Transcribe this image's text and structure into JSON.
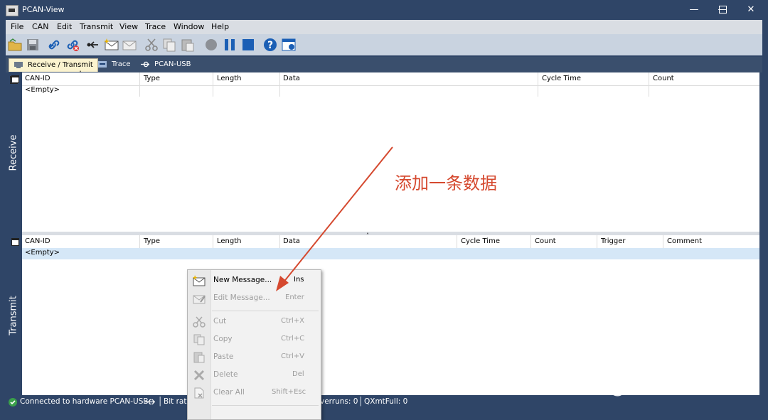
{
  "window": {
    "title": "PCAN-View"
  },
  "menu": [
    "File",
    "CAN",
    "Edit",
    "Transmit",
    "View",
    "Trace",
    "Window",
    "Help"
  ],
  "tabs": [
    "Receive / Transmit",
    "Trace",
    "PCAN-USB"
  ],
  "receive": {
    "side_label": "Receive",
    "columns": [
      "CAN-ID",
      "Type",
      "Length",
      "Data",
      "Cycle Time",
      "Count"
    ],
    "empty_text": "<Empty>"
  },
  "transmit": {
    "side_label": "Transmit",
    "columns": [
      "CAN-ID",
      "Type",
      "Length",
      "Data",
      "Cycle Time",
      "Count",
      "Trigger",
      "Comment"
    ],
    "empty_text": "<Empty>"
  },
  "context_menu": {
    "items": [
      {
        "label": "New Message...",
        "shortcut": "Ins",
        "icon": "new-message-icon",
        "enabled": true
      },
      {
        "label": "Edit Message...",
        "shortcut": "Enter",
        "icon": "edit-message-icon",
        "enabled": false
      },
      {
        "label": "Cut",
        "shortcut": "Ctrl+X",
        "icon": "cut-icon",
        "enabled": false
      },
      {
        "label": "Copy",
        "shortcut": "Ctrl+C",
        "icon": "copy-icon",
        "enabled": false
      },
      {
        "label": "Paste",
        "shortcut": "Ctrl+V",
        "icon": "paste-icon",
        "enabled": false
      },
      {
        "label": "Delete",
        "shortcut": "Del",
        "icon": "delete-icon",
        "enabled": false
      },
      {
        "label": "Clear All",
        "shortcut": "Shift+Esc",
        "icon": "clear-all-icon",
        "enabled": false
      }
    ]
  },
  "status": {
    "connection": "Connected to hardware PCAN-USB",
    "bitrate": "Bit rate",
    "overruns": "verruns: 0",
    "qxmtfull": "QXmtFull: 0"
  },
  "annotation": "添加一条数据",
  "watermark": "知乎 @安信可科技",
  "colors": {
    "titlebar": "#2f4567",
    "accent_annotation": "#d5492f",
    "selected_row": "#d5e7f7"
  }
}
